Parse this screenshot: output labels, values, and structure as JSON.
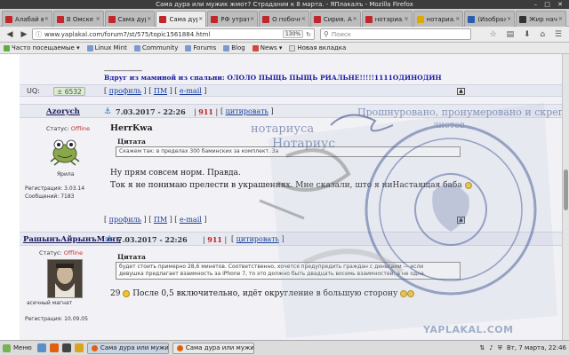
{
  "window": {
    "title": "Сама дура или мужик жмот? Страдания к 8 марта. - ЯПлакалъ - Mozilla Firefox"
  },
  "tabs": [
    {
      "label": "Алабай в ...",
      "icon": "yaplakal-favicon"
    },
    {
      "label": "В Омске и...",
      "icon": "yaplakal-favicon"
    },
    {
      "label": "Сама дура...",
      "icon": "yaplakal-favicon"
    },
    {
      "label": "Сама дура...",
      "icon": "yaplakal-favicon",
      "active": true
    },
    {
      "label": "РФ утрати...",
      "icon": "yaplakal-favicon"
    },
    {
      "label": "О побочн...",
      "icon": "yaplakal-favicon"
    },
    {
      "label": "Сирия. Ар...",
      "icon": "yaplakal-favicon"
    },
    {
      "label": "нотариал...",
      "icon": "yaplakal-favicon"
    },
    {
      "label": "нотариал...",
      "icon": "yandex-favicon"
    },
    {
      "label": "(Изображ...",
      "icon": "image-favicon"
    },
    {
      "label": "Жир начс...",
      "icon": "dark-favicon"
    }
  ],
  "nav": {
    "url": "www.yaplakal.com/forum7/st/575/topic1561884.html",
    "zoom": "130%",
    "search_placeholder": "Поиск"
  },
  "bookmarks": [
    {
      "label": "Часто посещаемые ▾",
      "icon": "gear-icon"
    },
    {
      "label": "Linux Mint",
      "icon": "folder-icon"
    },
    {
      "label": "Community",
      "icon": "folder-icon"
    },
    {
      "label": "Forums",
      "icon": "folder-icon"
    },
    {
      "label": "Blog",
      "icon": "folder-icon"
    },
    {
      "label": "News ▾",
      "icon": "rss-icon"
    },
    {
      "label": "Новая вкладка",
      "icon": "page-icon"
    }
  ],
  "prev_post": {
    "separator": "---------------------",
    "bold_line": "Вдруг из маминой из спальни: ОЛОЛО ПЫЩЬ ПЫЩЬ РИАЛЬНЕ!!!!!1111ОДИНОДИН",
    "uq_label": "UQ:",
    "rating": "6532",
    "links": {
      "profile": "профиль",
      "pm": "ПМ",
      "email": "e-mail"
    }
  },
  "posts": [
    {
      "author": "Azorych",
      "date": "7.03.2017 - 22:26",
      "number": "911",
      "cite": "цитировать",
      "status_label": "Статус:",
      "status": "Offline",
      "avatar_caption": "Ярила",
      "registration": "Регистрация: 3.03.14",
      "messages": "Сообщений: 7183",
      "title": "HerrKwa",
      "quote_label": "Цитата",
      "quote": "Скажем так: в пределах 300 баминских за комплект. За",
      "text1": "Ну прям совсем норм. Правда.",
      "text2": "Ток я не понимаю прелести в украшениях. Мне сказали, што я ниНастаящая баба",
      "links": {
        "profile": "профиль",
        "pm": "ПМ",
        "email": "e-mail"
      }
    },
    {
      "author": "РашынъАйрынъМэнъ",
      "date": "7.03.2017 - 22:26",
      "number": "911",
      "cite": "цитировать",
      "status_label": "Статус:",
      "status": "Offline",
      "avatar_caption": "асечный магнат",
      "registration": "Регистрация: 10.09.05",
      "quote_label": "Цитата",
      "quote_line1": "будет стоить примерно 28,6 минетов. Соответственно, хочется предупредить граждан с деньгами — если",
      "quote_line2": "девушка предлагает взаимность за iPhone 7, то это должно быть двадцать восемь взаимностей, а не одна.",
      "text_num": "29",
      "text": "После 0,5 включительно, идёт округление в большую сторону"
    }
  ],
  "watermark": "YAPLAKAL.COM",
  "stamp_text": {
    "top": "Прошнуровано, пронумеровано и скреплено печатью",
    "notary": "нотариуса",
    "sheets": "листов",
    "notary2": "Нотариус"
  },
  "taskbar": {
    "menu": "Меню",
    "tasks": [
      "Сама дура или мужик ж...",
      "Сама дура или мужик ж..."
    ],
    "clock": "Вт, 7 марта, 22:46"
  }
}
